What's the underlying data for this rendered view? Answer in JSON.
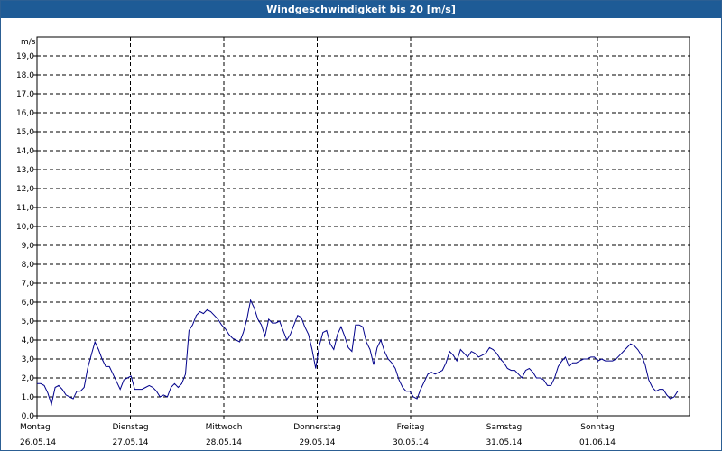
{
  "window": {
    "title": "Windgeschwindigkeit bis 20 [m/s]"
  },
  "chart_data": {
    "type": "line",
    "title": "Windgeschwindigkeit bis 20 [m/s]",
    "ylabel": "m/s",
    "ylim": [
      0,
      20
    ],
    "yticks": [
      "0,0",
      "1,0",
      "2,0",
      "3,0",
      "4,0",
      "5,0",
      "6,0",
      "7,0",
      "8,0",
      "9,0",
      "10,0",
      "11,0",
      "12,0",
      "13,0",
      "14,0",
      "15,0",
      "16,0",
      "17,0",
      "18,0",
      "19,0"
    ],
    "grid": true,
    "x_unit": "days since 26.05.14 00:00",
    "days": [
      {
        "day": "Montag",
        "date": "26.05.14"
      },
      {
        "day": "Dienstag",
        "date": "27.05.14"
      },
      {
        "day": "Mittwoch",
        "date": "28.05.14"
      },
      {
        "day": "Donnerstag",
        "date": "29.05.14"
      },
      {
        "day": "Freitag",
        "date": "30.05.14"
      },
      {
        "day": "Samstag",
        "date": "31.05.14"
      },
      {
        "day": "Sonntag",
        "date": "01.06.14"
      }
    ],
    "series": [
      {
        "name": "Windgeschwindigkeit",
        "color": "#00008b",
        "x": [
          0.0,
          0.039,
          0.077,
          0.116,
          0.155,
          0.194,
          0.232,
          0.271,
          0.31,
          0.349,
          0.387,
          0.426,
          0.465,
          0.504,
          0.542,
          0.581,
          0.62,
          0.659,
          0.697,
          0.736,
          0.775,
          0.814,
          0.852,
          0.891,
          0.93,
          0.969,
          1.007,
          1.046,
          1.085,
          1.124,
          1.162,
          1.201,
          1.24,
          1.279,
          1.317,
          1.356,
          1.395,
          1.434,
          1.472,
          1.511,
          1.55,
          1.589,
          1.627,
          1.666,
          1.705,
          1.744,
          1.782,
          1.821,
          1.86,
          1.899,
          1.937,
          1.976,
          2.015,
          2.054,
          2.092,
          2.131,
          2.17,
          2.209,
          2.247,
          2.286,
          2.325,
          2.364,
          2.402,
          2.441,
          2.48,
          2.519,
          2.557,
          2.596,
          2.635,
          2.674,
          2.712,
          2.751,
          2.79,
          2.829,
          2.867,
          2.906,
          2.945,
          2.984,
          3.022,
          3.061,
          3.1,
          3.139,
          3.177,
          3.216,
          3.255,
          3.294,
          3.332,
          3.371,
          3.41,
          3.449,
          3.487,
          3.526,
          3.565,
          3.604,
          3.642,
          3.681,
          3.72,
          3.759,
          3.797,
          3.836,
          3.875,
          3.914,
          3.952,
          3.991,
          4.03,
          4.069,
          4.107,
          4.146,
          4.185,
          4.224,
          4.262,
          4.301,
          4.34,
          4.379,
          4.417,
          4.456,
          4.495,
          4.534,
          4.572,
          4.611,
          4.65,
          4.689,
          4.727,
          4.766,
          4.805,
          4.844,
          4.882,
          4.921,
          4.96,
          4.999,
          5.037,
          5.076,
          5.115,
          5.154,
          5.192,
          5.231,
          5.27,
          5.309,
          5.347,
          5.386,
          5.425,
          5.464,
          5.502,
          5.541,
          5.58,
          5.619,
          5.657,
          5.696,
          5.735,
          5.774,
          5.812,
          5.851,
          5.89,
          5.929,
          5.967,
          6.006,
          6.045,
          6.084,
          6.122,
          6.161,
          6.2,
          6.239,
          6.277,
          6.316,
          6.355,
          6.394,
          6.432,
          6.471,
          6.51,
          6.549,
          6.587,
          6.626,
          6.665,
          6.704,
          6.742,
          6.781,
          6.82,
          6.859
        ],
        "values": [
          1.7,
          1.7,
          1.6,
          1.2,
          0.6,
          1.5,
          1.6,
          1.4,
          1.1,
          1.0,
          0.9,
          1.3,
          1.3,
          1.5,
          2.5,
          3.2,
          3.9,
          3.5,
          3.0,
          2.6,
          2.6,
          2.2,
          1.8,
          1.4,
          1.9,
          2.0,
          2.1,
          1.4,
          1.4,
          1.4,
          1.5,
          1.6,
          1.5,
          1.3,
          1.0,
          1.1,
          1.0,
          1.5,
          1.7,
          1.5,
          1.7,
          2.2,
          4.5,
          4.8,
          5.3,
          5.5,
          5.4,
          5.6,
          5.5,
          5.3,
          5.1,
          4.8,
          4.6,
          4.3,
          4.1,
          4.0,
          3.9,
          4.4,
          5.1,
          6.1,
          5.7,
          5.1,
          4.8,
          4.2,
          5.1,
          4.9,
          4.9,
          5.0,
          4.5,
          4.0,
          4.3,
          4.8,
          5.3,
          5.2,
          4.7,
          4.3,
          3.5,
          2.5,
          3.7,
          4.4,
          4.5,
          3.8,
          3.5,
          4.3,
          4.7,
          4.2,
          3.6,
          3.4,
          4.8,
          4.8,
          4.7,
          3.9,
          3.5,
          2.7,
          3.6,
          4.0,
          3.4,
          3.0,
          2.8,
          2.5,
          1.9,
          1.5,
          1.3,
          1.3,
          1.0,
          0.9,
          1.4,
          1.8,
          2.2,
          2.3,
          2.2,
          2.3,
          2.4,
          2.8,
          3.4,
          3.2,
          2.9,
          3.5,
          3.3,
          3.1,
          3.4,
          3.3,
          3.1,
          3.2,
          3.3,
          3.6,
          3.5,
          3.3,
          3.0,
          2.8,
          2.5,
          2.4,
          2.4,
          2.2,
          2.0,
          2.4,
          2.5,
          2.3,
          2.0,
          2.0,
          1.9,
          1.6,
          1.6,
          2.0,
          2.6,
          2.9,
          3.1,
          2.6,
          2.8,
          2.8,
          2.9,
          3.0,
          3.0,
          3.1,
          3.1,
          2.9,
          3.0,
          2.9,
          2.9,
          2.9,
          3.0,
          3.2,
          3.4,
          3.6,
          3.8,
          3.7,
          3.5,
          3.2,
          2.7,
          1.9,
          1.5,
          1.3,
          1.4,
          1.4,
          1.1,
          0.9,
          1.0,
          1.3
        ]
      }
    ]
  }
}
